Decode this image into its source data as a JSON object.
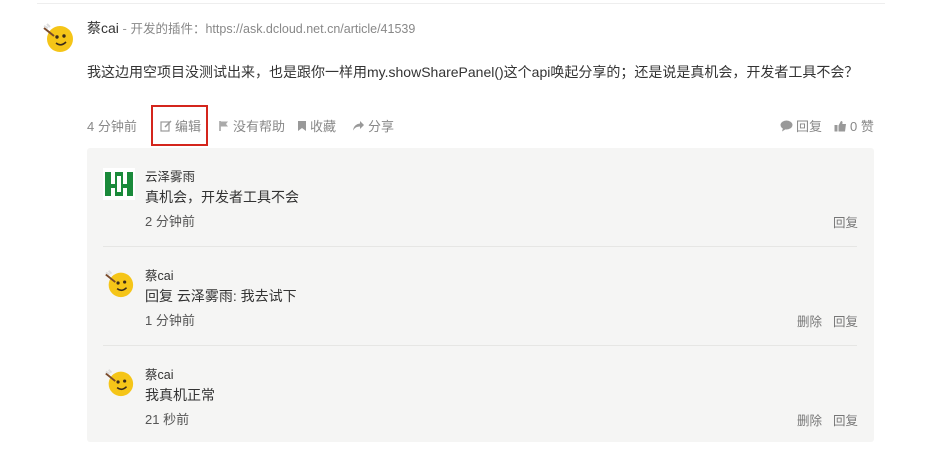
{
  "answer": {
    "author": "蔡cai",
    "separator": " - ",
    "signature": "开发的插件：https://ask.dcloud.net.cn/article/41539",
    "text": "我这边用空项目没测试出来，也是跟你一样用my.showSharePanel()这个api唤起分享的；还是说是真机会，开发者工具不会？",
    "time": "4 分钟前",
    "actions": {
      "edit": "编辑",
      "not_helpful": "没有帮助",
      "favorite": "收藏",
      "share": "分享",
      "reply": "回复",
      "like_count": "0 赞"
    }
  },
  "comments": [
    {
      "author": "云泽雾雨",
      "text": "真机会，开发者工具不会",
      "time": "2 分钟前",
      "reply": "回复"
    },
    {
      "author": "蔡cai",
      "text": "回复 云泽雾雨: 我去试下",
      "time": "1 分钟前",
      "delete": "删除",
      "reply": "回复"
    },
    {
      "author": "蔡cai",
      "text": "我真机正常",
      "time": "21 秒前",
      "delete": "删除",
      "reply": "回复"
    }
  ],
  "colors": {
    "highlight_border": "#d4251c",
    "comment_bg": "#f5f5f4",
    "muted_text": "#888888"
  }
}
